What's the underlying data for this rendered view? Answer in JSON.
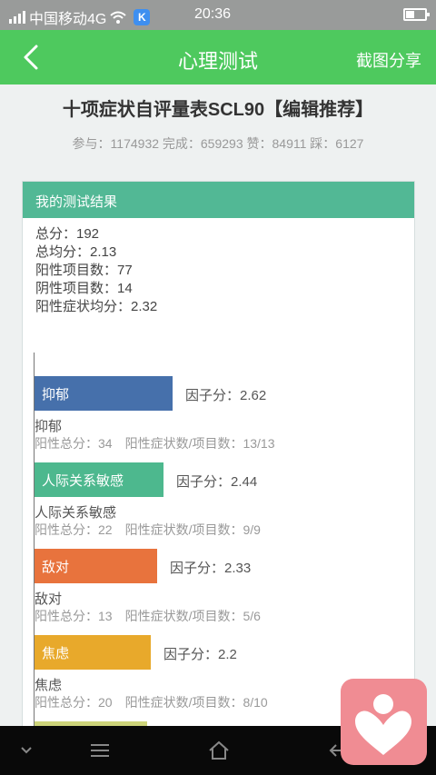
{
  "status_bar": {
    "carrier": "中国移动4G",
    "app_badge": "K",
    "time": "20:36",
    "icons": [
      "signal-icon",
      "wifi-icon",
      "battery-icon"
    ]
  },
  "header": {
    "title": "心理测试",
    "share_label": "截图分享",
    "back_icon": "back-arrow-icon"
  },
  "test": {
    "title": "十项症状自评量表SCL90【编辑推荐】",
    "stats": "参与：1174932 完成：659293 赞：84911 踩：6127"
  },
  "result": {
    "heading": "我的测试结果",
    "summary": [
      "总分：192",
      "总均分：2.13",
      "阳性项目数：77",
      "阴性项目数：14",
      "阳性症状均分：2.32"
    ]
  },
  "chart_data": {
    "type": "bar",
    "orientation": "horizontal",
    "categories": [
      "抑郁",
      "人际关系敏感",
      "敌对",
      "焦虑"
    ],
    "values": [
      2.62,
      2.44,
      2.33,
      2.2
    ],
    "score_labels": [
      "因子分：2.62",
      "因子分：2.44",
      "因子分：2.33",
      "因子分：2.2"
    ],
    "details": [
      "阳性总分：34　阳性症状数/项目数：13/13",
      "阳性总分：22　阳性症状数/项目数：9/9",
      "阳性总分：13　阳性症状数/项目数：5/6",
      "阳性总分：20　阳性症状数/项目数：8/10"
    ],
    "colors": [
      "#4670ab",
      "#4db88e",
      "#e8733d",
      "#e8a92b"
    ],
    "partial_next_bar_color": "#cdd47a"
  },
  "navigation": {
    "icons": [
      "chevron-down-icon",
      "menu-icon",
      "home-icon",
      "back-icon"
    ]
  },
  "floating_widget": {
    "icon": "heart-person-icon",
    "color": "#f08c93"
  }
}
